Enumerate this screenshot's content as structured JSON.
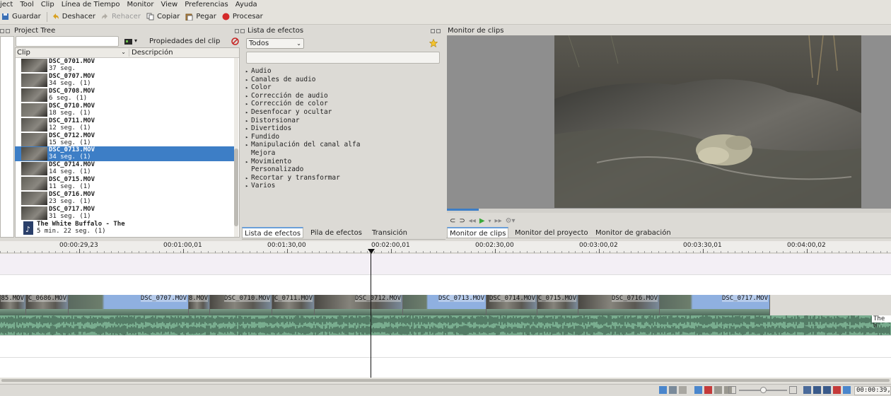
{
  "menu": [
    "ject",
    "Tool",
    "Clip",
    "Línea de Tiempo",
    "Monitor",
    "View",
    "Preferencias",
    "Ayuda"
  ],
  "toolbar": {
    "save": "Guardar",
    "undo": "Deshacer",
    "redo": "Rehacer",
    "copy": "Copiar",
    "paste": "Pegar",
    "render": "Procesar"
  },
  "project": {
    "title": "Project Tree",
    "clip_props": "Propiedades del clip",
    "col_clip": "Clip",
    "col_desc": "Descripción",
    "clips": [
      {
        "name": "DSC_0701.MOV",
        "dur": "37 seg."
      },
      {
        "name": "DSC_0707.MOV",
        "dur": "34 seg. (1)"
      },
      {
        "name": "DSC_0708.MOV",
        "dur": "6 seg. (1)"
      },
      {
        "name": "DSC_0710.MOV",
        "dur": "18 seg. (1)"
      },
      {
        "name": "DSC_0711.MOV",
        "dur": "12 seg. (1)"
      },
      {
        "name": "DSC_0712.MOV",
        "dur": "15 seg. (1)"
      },
      {
        "name": "DSC_0713.MOV",
        "dur": "34 seg. (1)"
      },
      {
        "name": "DSC_0714.MOV",
        "dur": "14 seg. (1)"
      },
      {
        "name": "DSC_0715.MOV",
        "dur": "11 seg. (1)"
      },
      {
        "name": "DSC_0716.MOV",
        "dur": "23 seg. (1)"
      },
      {
        "name": "DSC_0717.MOV",
        "dur": "31 seg. (1)"
      }
    ],
    "audio": {
      "name": "The White Buffalo  - The",
      "dur": "5 min. 22 seg. (1)"
    }
  },
  "effects": {
    "title": "Lista de efectos",
    "filter": "Todos",
    "categories": [
      "Audio",
      "Canales de audio",
      "Color",
      "Corrección de audio",
      "Corrección de color",
      "Desenfocar y ocultar",
      "Distorsionar",
      "Divertidos",
      "Fundido",
      "Manipulación del canal alfa",
      "Mejora",
      "Movimiento",
      "Personalizado",
      "Recortar y transformar",
      "Varios"
    ],
    "tabs": [
      "Lista de efectos",
      "Pila de efectos",
      "Transición"
    ]
  },
  "monitor": {
    "title": "Monitor de clips",
    "tabs": [
      "Monitor de clips",
      "Monitor del proyecto",
      "Monitor de grabación"
    ]
  },
  "timeline": {
    "ticks": [
      "00:00:29,23",
      "00:01:00,01",
      "00:01:30,00",
      "00:02:00,01",
      "00:02:30,00",
      "00:03:00,02",
      "00:03:30,01",
      "00:04:00,02"
    ],
    "clips": [
      "85.MOV",
      "C_0686.MOV",
      "DSC_0707.MOV",
      "8.MOV",
      "DSC_0710.MOV",
      "C_0711.MOV",
      "DSC_0712.MOV",
      "DSC_0713.MOV",
      "DSC_0714.MOV",
      "C_0715.MOV",
      "DSC_0716.MOV",
      "DSC_0717.MOV"
    ],
    "audio_label": "The W"
  },
  "status": {
    "timecode": "00:00:39,0"
  }
}
